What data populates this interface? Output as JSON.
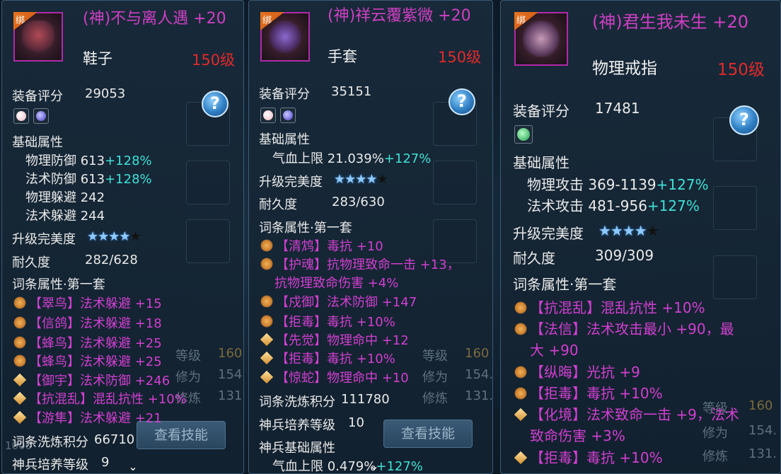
{
  "cards": [
    {
      "bind": "绑",
      "title": "(神)不与离人遇 +20",
      "type": "鞋子",
      "level": "150级",
      "score_label": "装备评分",
      "score": "29053",
      "help": "?",
      "base_label": "基础属性",
      "base": [
        {
          "name": "物理防御 613",
          "bonus": "+128%"
        },
        {
          "name": "法术防御 613",
          "bonus": "+128%"
        },
        {
          "name": "物理躲避 242",
          "bonus": ""
        },
        {
          "name": "法术躲避 244",
          "bonus": ""
        }
      ],
      "perfection_label": "升级完美度",
      "stars": 4,
      "stars_total": 5,
      "durability_label": "耐久度",
      "durability": "282/628",
      "affix_label": "词条属性·第一套",
      "affixes": [
        {
          "icon": "swirl",
          "text": "【翠鸟】法术躲避 +15"
        },
        {
          "icon": "swirl",
          "text": "【信鸽】法术躲避 +18"
        },
        {
          "icon": "swirl",
          "text": "【蜂鸟】法术躲避 +25"
        },
        {
          "icon": "swirl",
          "text": "【蜂鸟】法术躲避 +25"
        },
        {
          "icon": "diamond",
          "text": "【御宇】法术防御 +246"
        },
        {
          "icon": "diamond",
          "text": "【抗混乱】混乱抗性 +10%"
        },
        {
          "icon": "diamond",
          "text": "【游隼】法术躲避 +21"
        }
      ],
      "refine_label": "词条洗炼积分",
      "refine": "66710",
      "cultivate_label": "神兵培养等级",
      "cultivate": "9"
    },
    {
      "bind": "绑",
      "title": "(神)祥云覆紫微 +20",
      "type": "手套",
      "level": "150级",
      "score_label": "装备评分",
      "score": "35151",
      "help": "?",
      "base_label": "基础属性",
      "base": [
        {
          "name": "气血上限 21.039%",
          "bonus": "+127%"
        }
      ],
      "perfection_label": "升级完美度",
      "stars": 4,
      "stars_total": 5,
      "durability_label": "耐久度",
      "durability": "283/630",
      "affix_label": "词条属性·第一套",
      "affixes": [
        {
          "icon": "swirl",
          "text": "【清鸩】毒抗 +10"
        },
        {
          "icon": "swirl",
          "text": "【护魂】抗物理致命一击 +13，"
        },
        {
          "icon": "",
          "text": "抗物理致命伤害 +4%"
        },
        {
          "icon": "swirl",
          "text": "【戍御】法术防御 +147"
        },
        {
          "icon": "swirl",
          "text": "【拒毒】毒抗 +10%"
        },
        {
          "icon": "diamond",
          "text": "【先觉】物理命中 +12"
        },
        {
          "icon": "diamond",
          "text": "【拒毒】毒抗 +10%"
        },
        {
          "icon": "diamond",
          "text": "【惊蛇】物理命中 +10"
        }
      ],
      "refine_label": "词条洗炼积分",
      "refine": "111780",
      "cultivate_label": "神兵培养等级",
      "cultivate": "10",
      "divine_label": "神兵基础属性",
      "divine": {
        "name": "气血上限 0.479%",
        "bonus": "+127%"
      }
    },
    {
      "bind": "绑",
      "title": "(神)君生我未生 +20",
      "type": "物理戒指",
      "level": "150级",
      "score_label": "装备评分",
      "score": "17481",
      "help": "?",
      "base_label": "基础属性",
      "base": [
        {
          "name": "物理攻击 369-1139",
          "bonus": "+127%"
        },
        {
          "name": "法术攻击 481-956",
          "bonus": "+127%"
        }
      ],
      "perfection_label": "升级完美度",
      "stars": 4,
      "stars_total": 5,
      "durability_label": "耐久度",
      "durability": "309/309",
      "affix_label": "词条属性·第一套",
      "affixes": [
        {
          "icon": "swirl",
          "text": "【抗混乱】混乱抗性 +10%"
        },
        {
          "icon": "swirl",
          "text": "【法信】法术攻击最小 +90，最"
        },
        {
          "icon": "",
          "text": "大 +90"
        },
        {
          "icon": "swirl",
          "text": "【纵晦】光抗 +9"
        },
        {
          "icon": "swirl",
          "text": "【拒毒】毒抗 +10%"
        },
        {
          "icon": "diamond",
          "text": "【化境】法术致命一击 +9，法术"
        },
        {
          "icon": "",
          "text": "致命伤害 +3%"
        },
        {
          "icon": "diamond",
          "text": "【拒毒】毒抗 +10%"
        }
      ]
    }
  ],
  "background": {
    "level_label": "等级",
    "level_value": "160",
    "cultivate_label": "修为",
    "cultivate_value": "154.",
    "practice_label": "修炼",
    "practice_value": "131.",
    "skill_button": "查看技能",
    "bottom_left": "1000"
  }
}
